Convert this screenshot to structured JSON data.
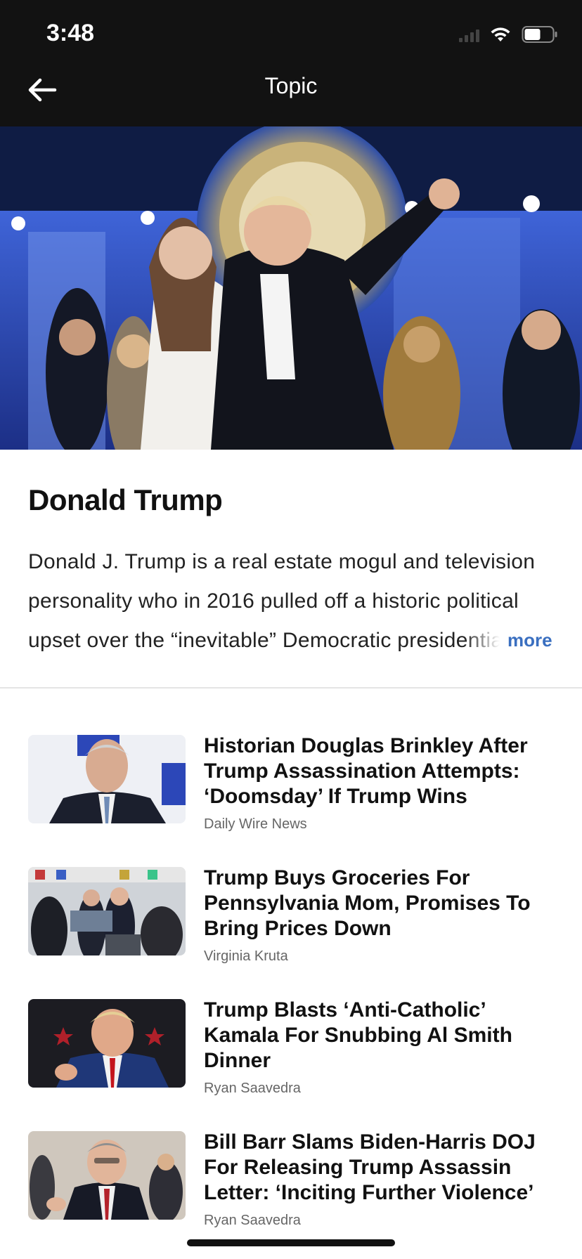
{
  "status_bar": {
    "time": "3:48"
  },
  "nav": {
    "title": "Topic",
    "back_icon": "arrow-left-icon"
  },
  "hero": {
    "image_alt": "Donald Trump with Melania Trump on stage in front of presidential seal"
  },
  "topic": {
    "title": "Donald Trump",
    "description": "Donald J. Trump is a real estate mogul and television personality who in 2016 pulled off a historic political upset over the “inevitable” Democratic presidential nominee",
    "more_label": "more"
  },
  "articles": [
    {
      "headline": "Historian Douglas Brinkley After Trump Assassination Attempts: ‘Doomsday’ If Trump Wins",
      "author": "Daily Wire News"
    },
    {
      "headline": "Trump Buys Groceries For Pennsylvania Mom, Promises To Bring Prices Down",
      "author": "Virginia Kruta"
    },
    {
      "headline": "Trump Blasts ‘Anti-Catholic’ Kamala For Snubbing Al Smith Dinner",
      "author": "Ryan Saavedra"
    },
    {
      "headline": "Bill Barr Slams Biden-Harris DOJ For Releasing Trump Assassin Letter: ‘Inciting Further Violence’",
      "author": "Ryan Saavedra"
    }
  ],
  "colors": {
    "topbar": "#121212",
    "accent_link": "#3a6fc0",
    "headline": "#111111",
    "author": "#666666"
  }
}
